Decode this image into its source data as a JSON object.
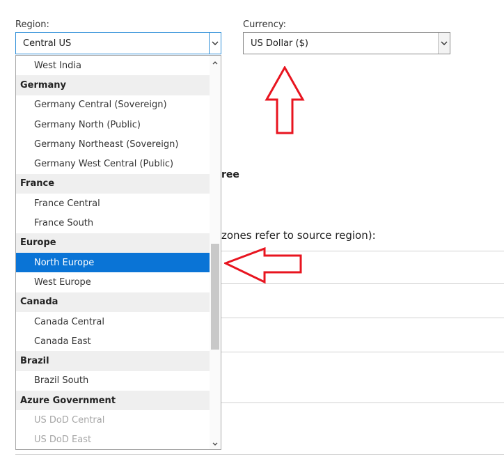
{
  "region": {
    "label": "Region:",
    "value": "Central US"
  },
  "currency": {
    "label": "Currency:",
    "value": "US Dollar ($)"
  },
  "background": {
    "fragment_1": "ree",
    "fragment_2": "zones refer to source region):"
  },
  "region_options": [
    {
      "type": "item",
      "label": "West India"
    },
    {
      "type": "group",
      "label": "Germany"
    },
    {
      "type": "item",
      "label": "Germany Central (Sovereign)"
    },
    {
      "type": "item",
      "label": "Germany North (Public)"
    },
    {
      "type": "item",
      "label": "Germany Northeast (Sovereign)"
    },
    {
      "type": "item",
      "label": "Germany West Central (Public)"
    },
    {
      "type": "group",
      "label": "France"
    },
    {
      "type": "item",
      "label": "France Central"
    },
    {
      "type": "item",
      "label": "France South"
    },
    {
      "type": "group",
      "label": "Europe"
    },
    {
      "type": "item",
      "label": "North Europe",
      "selected": true
    },
    {
      "type": "item",
      "label": "West Europe"
    },
    {
      "type": "group",
      "label": "Canada"
    },
    {
      "type": "item",
      "label": "Canada Central"
    },
    {
      "type": "item",
      "label": "Canada East"
    },
    {
      "type": "group",
      "label": "Brazil"
    },
    {
      "type": "item",
      "label": "Brazil South"
    },
    {
      "type": "group",
      "label": "Azure Government"
    },
    {
      "type": "item",
      "label": "US DoD Central",
      "disabled": true
    },
    {
      "type": "item",
      "label": "US DoD East",
      "disabled": true
    }
  ],
  "colors": {
    "selected": "#0a74d6",
    "annotation_arrow": "#e8141f",
    "focus_border": "#2f8fd8"
  },
  "icons": {
    "dropdown": "chevron-down-icon",
    "scroll_up": "chevron-up-icon",
    "scroll_down": "chevron-down-icon"
  }
}
